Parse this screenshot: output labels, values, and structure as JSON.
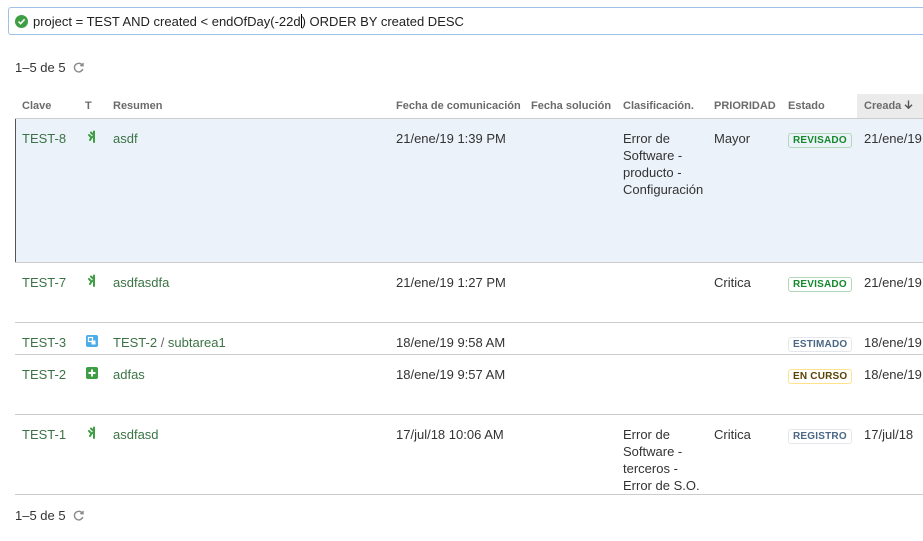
{
  "query": {
    "text_before_caret": "project = TEST AND created < endOfDay(-22d",
    "text_after_caret": ") ORDER BY created DESC",
    "status_icon": "check-circle-icon"
  },
  "pager": {
    "label": "1–5 de 5",
    "refresh_icon": "refresh-icon"
  },
  "columns": {
    "key": "Clave",
    "type": "T",
    "summary": "Resumen",
    "comm_date": "Fecha de comunicación",
    "solution_date": "Fecha solución",
    "classification": "Clasificación.",
    "priority": "PRIORIDAD",
    "status": "Estado",
    "created": "Creada"
  },
  "rows": [
    {
      "key": "TEST-8",
      "type_icon": "incident-icon",
      "summary": "asdf",
      "comm_date": "21/ene/19 1:39 PM",
      "solution_date": "",
      "classification": [
        "Error de",
        "Software -",
        "producto -",
        "Configuración"
      ],
      "priority": "Mayor",
      "status": "REVISADO",
      "status_color": "green",
      "created": "21/ene/19"
    },
    {
      "key": "TEST-7",
      "type_icon": "incident-icon",
      "summary": "asdfasdfa",
      "comm_date": "21/ene/19 1:27 PM",
      "solution_date": "",
      "classification": [],
      "priority": "Critica",
      "status": "REVISADO",
      "status_color": "green",
      "created": "21/ene/19"
    },
    {
      "key": "TEST-3",
      "type_icon": "subtask-icon",
      "summary_parent": "TEST-2",
      "summary_sep": " / ",
      "summary": "subtarea1",
      "comm_date": "18/ene/19 9:58 AM",
      "solution_date": "",
      "classification": [],
      "priority": "",
      "status": "ESTIMADO",
      "status_color": "grey",
      "created": "18/ene/19"
    },
    {
      "key": "TEST-2",
      "type_icon": "new-feature-icon",
      "summary": "adfas",
      "comm_date": "18/ene/19 9:57 AM",
      "solution_date": "",
      "classification": [],
      "priority": "",
      "status": "EN CURSO",
      "status_color": "yellow",
      "created": "18/ene/19"
    },
    {
      "key": "TEST-1",
      "type_icon": "incident-icon",
      "summary": "asdfasd",
      "comm_date": "17/jul/18 10:06 AM",
      "solution_date": "",
      "classification": [
        "Error de",
        "Software -",
        "terceros -",
        "Error de S.O."
      ],
      "priority": "Critica",
      "status": "REGISTRO",
      "status_color": "grey",
      "created": "17/jul/18"
    }
  ],
  "colors": {
    "link": "#3b7346",
    "focus_row": "#ebf2f9",
    "accent_green": "#14892c"
  }
}
